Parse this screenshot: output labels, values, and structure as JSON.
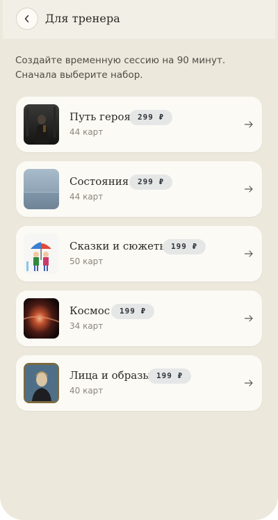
{
  "header": {
    "title": "Для тренера",
    "back_icon": "chevron-left-icon"
  },
  "intro": "Создайте временную сессию на 90 минут. Сначала выберите набор.",
  "decks": [
    {
      "title": "Путь героя",
      "price": "299 ₽",
      "count": "44 карт",
      "thumb": "hero-path-thumbnail"
    },
    {
      "title": "Состояния",
      "price": "299 ₽",
      "count": "44 карт",
      "thumb": "states-thumbnail"
    },
    {
      "title": "Сказки и сюжеты",
      "price": "199 ₽",
      "count": "50 карт",
      "thumb": "fairy-tales-thumbnail"
    },
    {
      "title": "Космос",
      "price": "199 ₽",
      "count": "34 карт",
      "thumb": "cosmos-thumbnail"
    },
    {
      "title": "Лица и образы",
      "price": "199 ₽",
      "count": "40 карт",
      "thumb": "faces-thumbnail"
    }
  ],
  "colors": {
    "background": "#ece8dc",
    "card": "#fbfaf5",
    "price_pill": "#e5e7e7",
    "text": "#2b2924",
    "muted": "#8a867c"
  }
}
